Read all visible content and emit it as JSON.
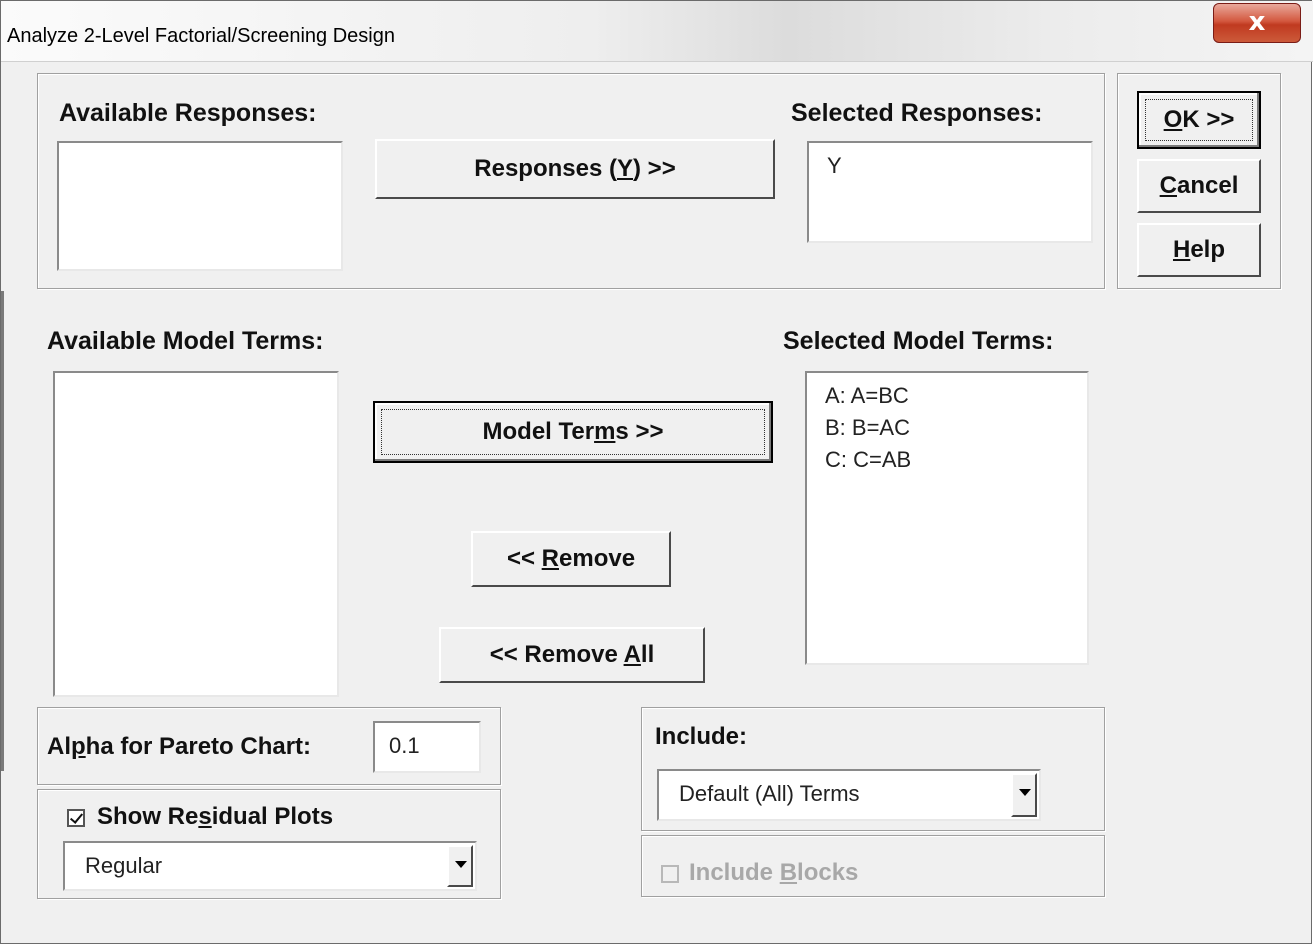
{
  "window": {
    "title": "Analyze 2-Level Factorial/Screening Design",
    "close_glyph": "x"
  },
  "responses": {
    "available_label": "Available Responses:",
    "selected_label": "Selected Responses:",
    "available_items": [],
    "selected_items": [
      "Y"
    ],
    "add_button": {
      "pre": "Responses (",
      "accel": "Y",
      "post": ") >>"
    }
  },
  "actions": {
    "ok": {
      "accel": "O",
      "rest": "K >>"
    },
    "cancel": {
      "accel": "C",
      "rest": "ancel"
    },
    "help": {
      "accel": "H",
      "rest": "elp"
    }
  },
  "model_terms": {
    "available_label": "Available Model Terms:",
    "selected_label": "Selected Model Terms:",
    "available_items": [],
    "selected_items": [
      "A: A=BC",
      "B: B=AC",
      "C: C=AB"
    ],
    "add_button": {
      "pre": "Model Ter",
      "accel": "m",
      "post": "s  >>"
    },
    "remove_button": {
      "pre": "<< ",
      "accel": "R",
      "post": "emove"
    },
    "remove_all_button": {
      "pre": "<< Remove ",
      "accel": "A",
      "post": "ll"
    }
  },
  "alpha": {
    "pre": "Al",
    "accel": "p",
    "post": "ha for Pareto Chart:",
    "value": "0.1"
  },
  "residual": {
    "checked": true,
    "pre": "Show Re",
    "accel": "s",
    "post": "idual Plots",
    "plot_type": "Regular"
  },
  "include": {
    "label": "Include:",
    "selected": "Default (All) Terms",
    "blocks": {
      "checked": false,
      "enabled": false,
      "pre": "Include ",
      "accel": "B",
      "post": "locks"
    }
  }
}
